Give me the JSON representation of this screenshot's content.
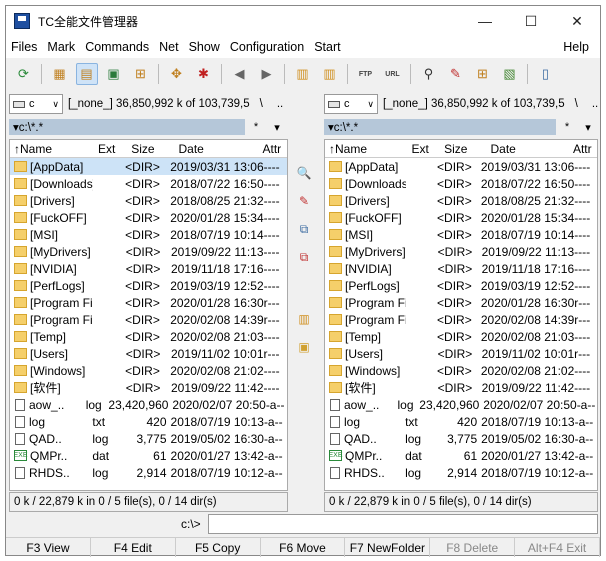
{
  "window": {
    "title": "TC全能文件管理器",
    "minimize": "—",
    "maximize": "☐",
    "close": "✕"
  },
  "menu": [
    "Files",
    "Mark",
    "Commands",
    "Net",
    "Show",
    "Configuration",
    "Start"
  ],
  "menu_help": "Help",
  "toolbar": [
    {
      "icon": "refresh-icon",
      "glyph": "⟳",
      "color": "#2a8a3a"
    },
    {
      "sep": true
    },
    {
      "icon": "brief-view-icon",
      "glyph": "▦",
      "color": "#c08020"
    },
    {
      "icon": "full-view-icon",
      "glyph": "▤",
      "color": "#c08020",
      "selected": true
    },
    {
      "icon": "thumbnail-view-icon",
      "glyph": "▣",
      "color": "#2a7a3a"
    },
    {
      "icon": "tree-view-icon",
      "glyph": "⊞",
      "color": "#c08020"
    },
    {
      "sep": true
    },
    {
      "icon": "invert-selection-icon",
      "glyph": "✥",
      "color": "#c08020"
    },
    {
      "icon": "select-all-icon",
      "glyph": "✱",
      "color": "#c02020"
    },
    {
      "sep": true
    },
    {
      "icon": "back-icon",
      "glyph": "◀",
      "color": "#666"
    },
    {
      "icon": "forward-icon",
      "glyph": "▶",
      "color": "#666"
    },
    {
      "sep": true
    },
    {
      "icon": "pack-icon",
      "glyph": "▥",
      "color": "#d09020"
    },
    {
      "icon": "unpack-icon",
      "glyph": "▥",
      "color": "#d09020"
    },
    {
      "sep": true
    },
    {
      "icon": "ftp-icon",
      "glyph": "FTP",
      "color": "#444"
    },
    {
      "icon": "url-icon",
      "glyph": "URL",
      "color": "#444"
    },
    {
      "sep": true
    },
    {
      "icon": "search-icon",
      "glyph": "⚲",
      "color": "#333"
    },
    {
      "icon": "multi-rename-icon",
      "glyph": "✎",
      "color": "#c03030"
    },
    {
      "icon": "sync-dirs-icon",
      "glyph": "⊞",
      "color": "#c08020"
    },
    {
      "icon": "compare-icon",
      "glyph": "▧",
      "color": "#4a8a3a"
    },
    {
      "sep": true
    },
    {
      "icon": "notepad-icon",
      "glyph": "▯",
      "color": "#3a6aa0"
    }
  ],
  "left": {
    "drive": "c",
    "drive_info": "[_none_]  36,850,992 k of 103,739,5",
    "drive_root": "\\",
    "drive_up": "..",
    "path": "▾c:\\*.*",
    "path_star": "*",
    "path_arrow": "▾",
    "status": "0 k / 22,879 k in 0 / 5 file(s), 0 / 14 dir(s)"
  },
  "right": {
    "drive": "c",
    "drive_info": "[_none_]  36,850,992 k of 103,739,5",
    "drive_root": "\\",
    "drive_up": "..",
    "path": "▾c:\\*.*",
    "path_star": "*",
    "path_arrow": "▾",
    "status": "0 k / 22,879 k in 0 / 5 file(s), 0 / 14 dir(s)"
  },
  "columns": {
    "name": "↑Name",
    "ext": "Ext",
    "size": "Size",
    "date": "Date",
    "attr": "Attr"
  },
  "files": [
    {
      "name": "[AppData]",
      "ext": "",
      "size": "<DIR>",
      "date": "2019/03/31 13:06",
      "attr": "----",
      "type": "dir"
    },
    {
      "name": "[Downloads]",
      "ext": "",
      "size": "<DIR>",
      "date": "2018/07/22 16:50",
      "attr": "----",
      "type": "dir"
    },
    {
      "name": "[Drivers]",
      "ext": "",
      "size": "<DIR>",
      "date": "2018/08/25 21:32",
      "attr": "----",
      "type": "dir"
    },
    {
      "name": "[FuckOFF]",
      "ext": "",
      "size": "<DIR>",
      "date": "2020/01/28 15:34",
      "attr": "----",
      "type": "dir"
    },
    {
      "name": "[MSI]",
      "ext": "",
      "size": "<DIR>",
      "date": "2018/07/19 10:14",
      "attr": "----",
      "type": "dir"
    },
    {
      "name": "[MyDrivers]",
      "ext": "",
      "size": "<DIR>",
      "date": "2019/09/22 11:13",
      "attr": "----",
      "type": "dir"
    },
    {
      "name": "[NVIDIA]",
      "ext": "",
      "size": "<DIR>",
      "date": "2019/11/18 17:16",
      "attr": "----",
      "type": "dir"
    },
    {
      "name": "[PerfLogs]",
      "ext": "",
      "size": "<DIR>",
      "date": "2019/03/19 12:52",
      "attr": "----",
      "type": "dir"
    },
    {
      "name": "[Program Fil..]",
      "ext": "",
      "size": "<DIR>",
      "date": "2020/01/28 16:30",
      "attr": "r---",
      "type": "dir"
    },
    {
      "name": "[Program Fil..]",
      "ext": "",
      "size": "<DIR>",
      "date": "2020/02/08 14:39",
      "attr": "r---",
      "type": "dir"
    },
    {
      "name": "[Temp]",
      "ext": "",
      "size": "<DIR>",
      "date": "2020/02/08 21:03",
      "attr": "----",
      "type": "dir"
    },
    {
      "name": "[Users]",
      "ext": "",
      "size": "<DIR>",
      "date": "2019/11/02 10:01",
      "attr": "r---",
      "type": "dir"
    },
    {
      "name": "[Windows]",
      "ext": "",
      "size": "<DIR>",
      "date": "2020/02/08 21:02",
      "attr": "----",
      "type": "dir"
    },
    {
      "name": "[软件]",
      "ext": "",
      "size": "<DIR>",
      "date": "2019/09/22 11:42",
      "attr": "----",
      "type": "dir"
    },
    {
      "name": "aow_..",
      "ext": "log",
      "size": "23,420,960",
      "date": "2020/02/07 20:50",
      "attr": "-a--",
      "type": "file"
    },
    {
      "name": "log",
      "ext": "txt",
      "size": "420",
      "date": "2018/07/19 10:13",
      "attr": "-a--",
      "type": "file"
    },
    {
      "name": "QAD..",
      "ext": "log",
      "size": "3,775",
      "date": "2019/05/02 16:30",
      "attr": "-a--",
      "type": "file"
    },
    {
      "name": "QMPr..",
      "ext": "dat",
      "size": "61",
      "date": "2020/01/27 13:42",
      "attr": "-a--",
      "type": "exe"
    },
    {
      "name": "RHDS..",
      "ext": "log",
      "size": "2,914",
      "date": "2018/07/19 10:12",
      "attr": "-a--",
      "type": "file"
    }
  ],
  "middle_buttons": [
    {
      "icon": "view-icon",
      "glyph": "🔍",
      "color": "#3a6aa0"
    },
    {
      "icon": "edit-icon",
      "glyph": "✎",
      "color": "#c03030"
    },
    {
      "icon": "copy-icon",
      "glyph": "⧉",
      "color": "#3a6aa0"
    },
    {
      "icon": "move-icon",
      "glyph": "⧉",
      "color": "#c03030"
    },
    {
      "icon": "pack-files-icon",
      "glyph": "▥",
      "color": "#d09020"
    },
    {
      "icon": "new-folder-icon",
      "glyph": "▣",
      "color": "#d0a030"
    }
  ],
  "cmdline": {
    "label": "c:\\>",
    "value": ""
  },
  "fkeys": [
    {
      "label": "F3 View",
      "dim": false
    },
    {
      "label": "F4 Edit",
      "dim": false
    },
    {
      "label": "F5 Copy",
      "dim": false
    },
    {
      "label": "F6 Move",
      "dim": false
    },
    {
      "label": "F7 NewFolder",
      "dim": false
    },
    {
      "label": "F8 Delete",
      "dim": true
    },
    {
      "label": "Alt+F4 Exit",
      "dim": true
    }
  ]
}
